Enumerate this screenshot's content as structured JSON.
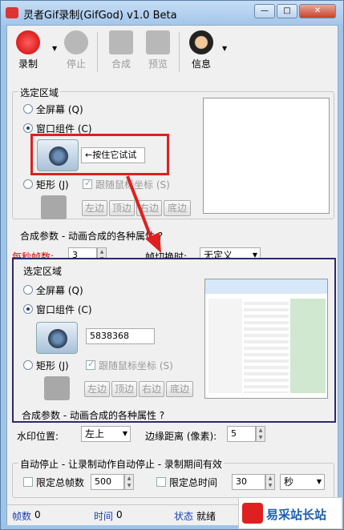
{
  "window": {
    "title": "灵者Gif录制(GifGod) v1.0 Beta",
    "min": "—",
    "max": "□",
    "close": "✕"
  },
  "toolbar": {
    "record": "录制",
    "stop": "停止",
    "merge": "合成",
    "preview": "预览",
    "info": "信息"
  },
  "region_top": {
    "title": "选定区域",
    "fullscreen": "全屏幕 (Q)",
    "window_comp": "窗口组件 (C)",
    "tip": "←按住它试试",
    "rect": "矩形 (J)",
    "follow": "跟随鼠标坐标 (S)",
    "left": "左边",
    "top": "顶边",
    "right": "右边",
    "bottom": "底边"
  },
  "params": {
    "title": "合成参数 - 动画合成的各种属性 ?",
    "fps_label": "每秒帧数:",
    "fps": "3",
    "switch_label": "帧切换时:",
    "switch": "无定义"
  },
  "region_overlay": {
    "title": "选定区域",
    "fullscreen": "全屏幕 (Q)",
    "window_comp": "窗口组件 (C)",
    "handle": "5838368",
    "rect": "矩形 (J)",
    "follow": "跟随鼠标坐标 (S)",
    "left": "左边",
    "top": "顶边",
    "right": "右边",
    "bottom": "底边",
    "footer": "合成参数 - 动画合成的各种属性 ?"
  },
  "watermark": {
    "pos_label": "水印位置:",
    "pos": "左上",
    "margin_label": "边缘距离 (像素):",
    "margin": "5"
  },
  "autostop": {
    "title": "自动停止 - 让录制动作自动停止 - 录制期间有效",
    "frames_label": "限定总帧数",
    "frames": "500",
    "time_label": "限定总时间",
    "time": "30",
    "unit": "秒"
  },
  "status": {
    "frames_label": "帧数",
    "frames": "0",
    "time_label": "时间",
    "time": "0",
    "state_label": "状态",
    "state": "就绪"
  },
  "watermark_logo": "易采站长站",
  "colors": {
    "highlight": "#e02020",
    "overlay_border": "#2a2a6a"
  }
}
